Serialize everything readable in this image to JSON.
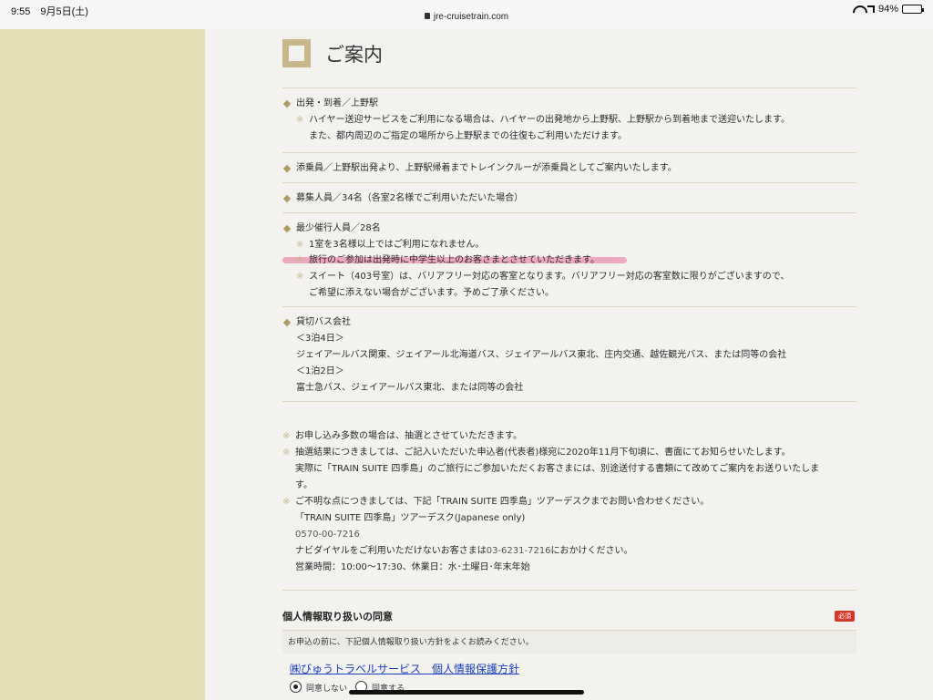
{
  "status_bar": {
    "time": "9:55　9月5日(土)",
    "url": "jre-cruisetrain.com",
    "battery": "94%",
    "battery_level": 0.94,
    "icons": [
      "lock-icon",
      "wifi-icon",
      "location-arrow-icon",
      "battery-icon"
    ]
  },
  "heading": {
    "title": "ご案内"
  },
  "mark": "※",
  "items": [
    {
      "title": "出発・到着／上野駅",
      "notes": [
        "ハイヤー送迎サービスをご利用になる場合は、ハイヤーの出発地から上野駅、上野駅から到着地まで送迎いたします。",
        "また、都内周辺のご指定の場所から上野駅までの往復もご利用いただけます。"
      ]
    },
    {
      "title": "添乗員／上野駅出発より、上野駅帰着までトレインクルーが添乗員としてご案内いたします。"
    },
    {
      "title": "募集人員／34名（各室2名様でご利用いただいた場合）"
    },
    {
      "title": "最少催行人員／28名",
      "notes": [
        "1室を3名様以上ではご利用になれません。",
        "旅行のご参加は出発時に中学生以上のお客さまとさせていただきます。",
        "スイート（403号室）は、バリアフリー対応の客室となります。バリアフリー対応の客室数に限りがございますので、",
        "ご希望に添えない場合がございます。予めご了承ください。"
      ]
    },
    {
      "title": "貸切バス会社",
      "lines": [
        "＜3泊4日＞",
        "ジェイアールバス関東、ジェイアール北海道バス、ジェイアールバス東北、庄内交通、越佐観光バス、または同等の会社",
        "＜1泊2日＞",
        "富士急バス、ジェイアールバス東北、または同等の会社"
      ]
    }
  ],
  "notices": {
    "n1": "お申し込み多数の場合は、抽選とさせていただきます。",
    "n2": "抽選結果につきましては、ご記入いただいた申込者(代表者)様宛に2020年11月下旬頃に、書面にてお知らせいたします。",
    "n2b": "実際に「TRAIN SUITE 四季島」のご旅行にご参加いただくお客さまには、別途送付する書類にて改めてご案内をお送りいたしま",
    "n2c": "す。",
    "n3": "ご不明な点につきましては、下記「TRAIN SUITE 四季島」ツアーデスクまでお問い合わせください。",
    "desk": "「TRAIN SUITE 四季島」ツアーデスク(Japanese only)",
    "phone1": "0570-00-7216",
    "navi_prefix": "ナビダイヤルをご利用いただけないお客さまは",
    "phone2": "03-6231-7216",
    "navi_suffix": "におかけください。",
    "hours": "営業時間：10:00〜17:30、休業日：水･土曜日･年末年始"
  },
  "privacy": {
    "title": "個人情報取り扱いの同意",
    "required": "必須",
    "note": "お申込の前に、下記個人情報取り扱い方針をよくお読みください。",
    "link": "㈱びゅうトラベルサービス　個人情報保護方針",
    "option_disagree": "同意しない",
    "option_agree": "同意する",
    "selected": "同意しない"
  },
  "colors": {
    "left_panel": "#e4ddb6",
    "accent": "#b09a60",
    "highlight": "#e86e96",
    "link": "#1a3fbf",
    "required_badge": "#d23a2a"
  }
}
